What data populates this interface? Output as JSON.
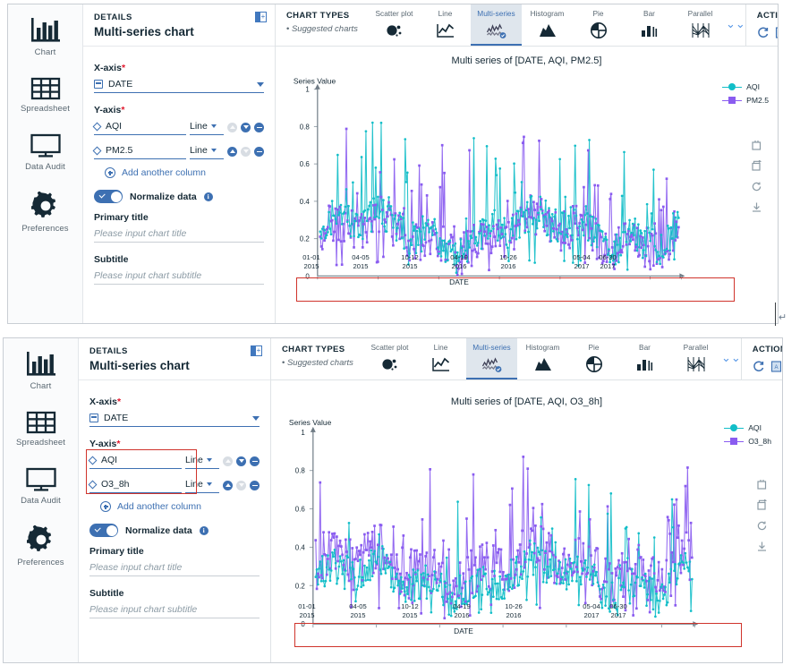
{
  "sidebar": {
    "items": [
      {
        "label": "Chart",
        "icon": "bar-chart-icon"
      },
      {
        "label": "Spreadsheet",
        "icon": "grid-table-icon"
      },
      {
        "label": "Data Audit",
        "icon": "monitor-icon"
      },
      {
        "label": "Preferences",
        "icon": "gear-icon"
      }
    ]
  },
  "details": {
    "kicker": "DETAILS",
    "title": "Multi-series chart",
    "collapse_icon": "panel-collapse-icon",
    "x_axis": {
      "label": "X-axis",
      "required_marker": "*",
      "value": "DATE",
      "icon": "calendar-icon"
    },
    "y_axis": {
      "label": "Y-axis",
      "required_marker": "*"
    },
    "y_rows_top": [
      {
        "name": "AQI",
        "type": "Line",
        "up_enabled": false,
        "down_enabled": true
      },
      {
        "name": "PM2.5",
        "type": "Line",
        "up_enabled": true,
        "down_enabled": false
      }
    ],
    "y_rows_bottom": [
      {
        "name": "AQI",
        "type": "Line",
        "up_enabled": false,
        "down_enabled": true
      },
      {
        "name": "O3_8h",
        "type": "Line",
        "up_enabled": true,
        "down_enabled": false
      }
    ],
    "add_column_label": "Add another column",
    "normalize": {
      "label": "Normalize data",
      "checked": true,
      "info_glyph": "i"
    },
    "primary_title": {
      "label": "Primary title",
      "value": "",
      "placeholder": "Please input chart title"
    },
    "subtitle": {
      "label": "Subtitle",
      "value": "",
      "placeholder": "Please input chart subtitle"
    }
  },
  "chart_types": {
    "kicker": "CHART TYPES",
    "suggested": "Suggested charts",
    "items": [
      {
        "label": "Scatter plot",
        "icon": "scatter-plot-icon",
        "active": false
      },
      {
        "label": "Line",
        "icon": "line-chart-icon",
        "active": false
      },
      {
        "label": "Multi-series",
        "icon": "multi-series-icon",
        "active": true
      },
      {
        "label": "Histogram",
        "icon": "histogram-icon",
        "active": false
      },
      {
        "label": "Pie",
        "icon": "pie-chart-icon",
        "active": false
      },
      {
        "label": "Bar",
        "icon": "bar-chart-icon",
        "active": false
      },
      {
        "label": "Parallel",
        "icon": "parallel-coords-icon",
        "active": false
      }
    ],
    "more_icon": "double-chevron-down-icon"
  },
  "actions": {
    "kicker": "ACTIONS",
    "items": [
      {
        "icon": "refresh-icon"
      },
      {
        "icon": "export-code-icon"
      },
      {
        "icon": "export-image-icon"
      },
      {
        "icon": "settings-gear-icon"
      }
    ]
  },
  "chart_tools": [
    {
      "icon": "zoom-box-icon"
    },
    {
      "icon": "zoom-back-icon"
    },
    {
      "icon": "restore-icon"
    },
    {
      "icon": "download-icon"
    }
  ],
  "colors": {
    "aqi": "#12bec8",
    "pm25": "#8a5cf0",
    "o3": "#8a5cf0",
    "accent": "#3d70b2",
    "highlight_box": "#d0342c",
    "active_tab_bg": "#dfe6ed",
    "text_dark": "#152935",
    "text_muted": "#5a6872"
  },
  "chart_data": [
    {
      "panel": "top",
      "type": "line",
      "title": "Multi series of [DATE, AQI, PM2.5]",
      "xlabel": "DATE",
      "ylabel": "Series Value",
      "ylim": [
        0,
        1
      ],
      "yticks": [
        "0",
        "0.2",
        "0.4",
        "0.6",
        "0.8",
        "1"
      ],
      "xticks": [
        {
          "line1": "01-01",
          "line2": "2015"
        },
        {
          "line1": "04-05",
          "line2": "2015"
        },
        {
          "line1": "10-12",
          "line2": "2015"
        },
        {
          "line1": "04-19",
          "line2": "2016"
        },
        {
          "line1": "10-26",
          "line2": "2016"
        },
        {
          "line1": "05-04",
          "line2": "2017"
        },
        {
          "line1": "06-30",
          "line2": "2017"
        }
      ],
      "grid": false,
      "legend_position": "right",
      "normalized": true,
      "series": [
        {
          "name": "AQI",
          "color": "#12bec8",
          "marker": "circle"
        },
        {
          "name": "PM2.5",
          "color": "#8a5cf0",
          "marker": "square"
        }
      ]
    },
    {
      "panel": "bottom",
      "type": "line",
      "title": "Multi series of [DATE, AQI, O3_8h]",
      "xlabel": "DATE",
      "ylabel": "Series Value",
      "ylim": [
        0,
        1
      ],
      "yticks": [
        "0",
        "0.2",
        "0.4",
        "0.6",
        "0.8",
        "1"
      ],
      "xticks": [
        {
          "line1": "01-01",
          "line2": "2015"
        },
        {
          "line1": "04-05",
          "line2": "2015"
        },
        {
          "line1": "10-12",
          "line2": "2015"
        },
        {
          "line1": "04-19",
          "line2": "2016"
        },
        {
          "line1": "10-26",
          "line2": "2016"
        },
        {
          "line1": "05-04",
          "line2": "2017"
        },
        {
          "line1": "06-30",
          "line2": "2017"
        }
      ],
      "grid": false,
      "legend_position": "right",
      "normalized": true,
      "series": [
        {
          "name": "AQI",
          "color": "#12bec8",
          "marker": "circle"
        },
        {
          "name": "O3_8h",
          "color": "#8a5cf0",
          "marker": "square"
        }
      ]
    }
  ],
  "annotations": {
    "pilcrow": "↵"
  }
}
